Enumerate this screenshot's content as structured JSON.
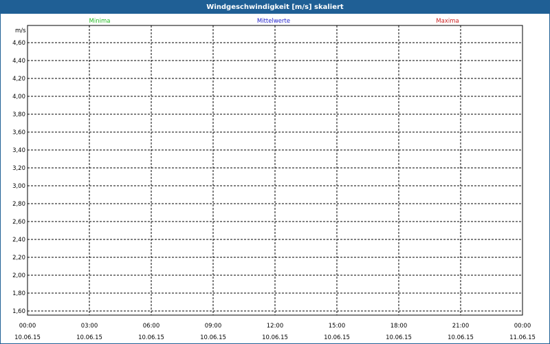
{
  "window": {
    "title": "Windgeschwindigkeit [m/s] skaliert"
  },
  "chart_data": {
    "type": "line",
    "ylabel": "m/s",
    "ylim": [
      1.6,
      4.7
    ],
    "y_ticks": [
      "4,60",
      "4,40",
      "4,20",
      "4,00",
      "3,80",
      "3,60",
      "3,40",
      "3,20",
      "3,00",
      "2,80",
      "2,60",
      "2,40",
      "2,20",
      "2,00",
      "1,80",
      "1,60"
    ],
    "x_ticks": [
      {
        "time": "00:00",
        "date": "10.06.15"
      },
      {
        "time": "03:00",
        "date": "10.06.15"
      },
      {
        "time": "06:00",
        "date": "10.06.15"
      },
      {
        "time": "09:00",
        "date": "10.06.15"
      },
      {
        "time": "12:00",
        "date": "10.06.15"
      },
      {
        "time": "15:00",
        "date": "10.06.15"
      },
      {
        "time": "18:00",
        "date": "10.06.15"
      },
      {
        "time": "21:00",
        "date": "10.06.15"
      },
      {
        "time": "00:00",
        "date": "11.06.15"
      }
    ],
    "grid": true,
    "series": [
      {
        "name": "Minima",
        "color": "#22bb22",
        "values": []
      },
      {
        "name": "Mittelwerte",
        "color": "#2222cc",
        "values": []
      },
      {
        "name": "Maxima",
        "color": "#cc2222",
        "values": []
      }
    ]
  }
}
